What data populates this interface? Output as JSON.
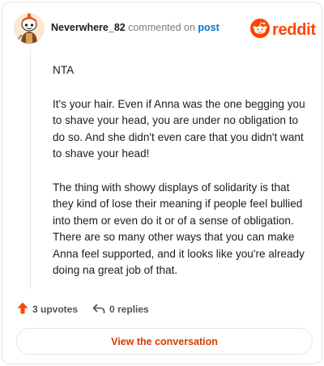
{
  "comment": {
    "author": "Neverwhere_82",
    "verb": "commented on",
    "target_link": "post",
    "paragraphs": [
      "NTA",
      "It's your hair. Even if Anna was the one begging you to shave your head, you are under no obligation to do so. And she didn't even care that you didn't want to shave your head!",
      "The thing with showy displays of solidarity is that they kind of lose their meaning if people feel bullied into them or even do it or of a sense of obligation. There are so many other ways that you can make Anna feel supported, and it looks like you're already doing na great job of that."
    ]
  },
  "brand": {
    "name": "reddit",
    "color": "#ff4500"
  },
  "actions": {
    "upvotes": "3 upvotes",
    "replies": "0 replies"
  },
  "view_button": "View the conversation",
  "icons": [
    "avatar",
    "reddit-logo-icon",
    "upvote-icon",
    "reply-icon"
  ]
}
